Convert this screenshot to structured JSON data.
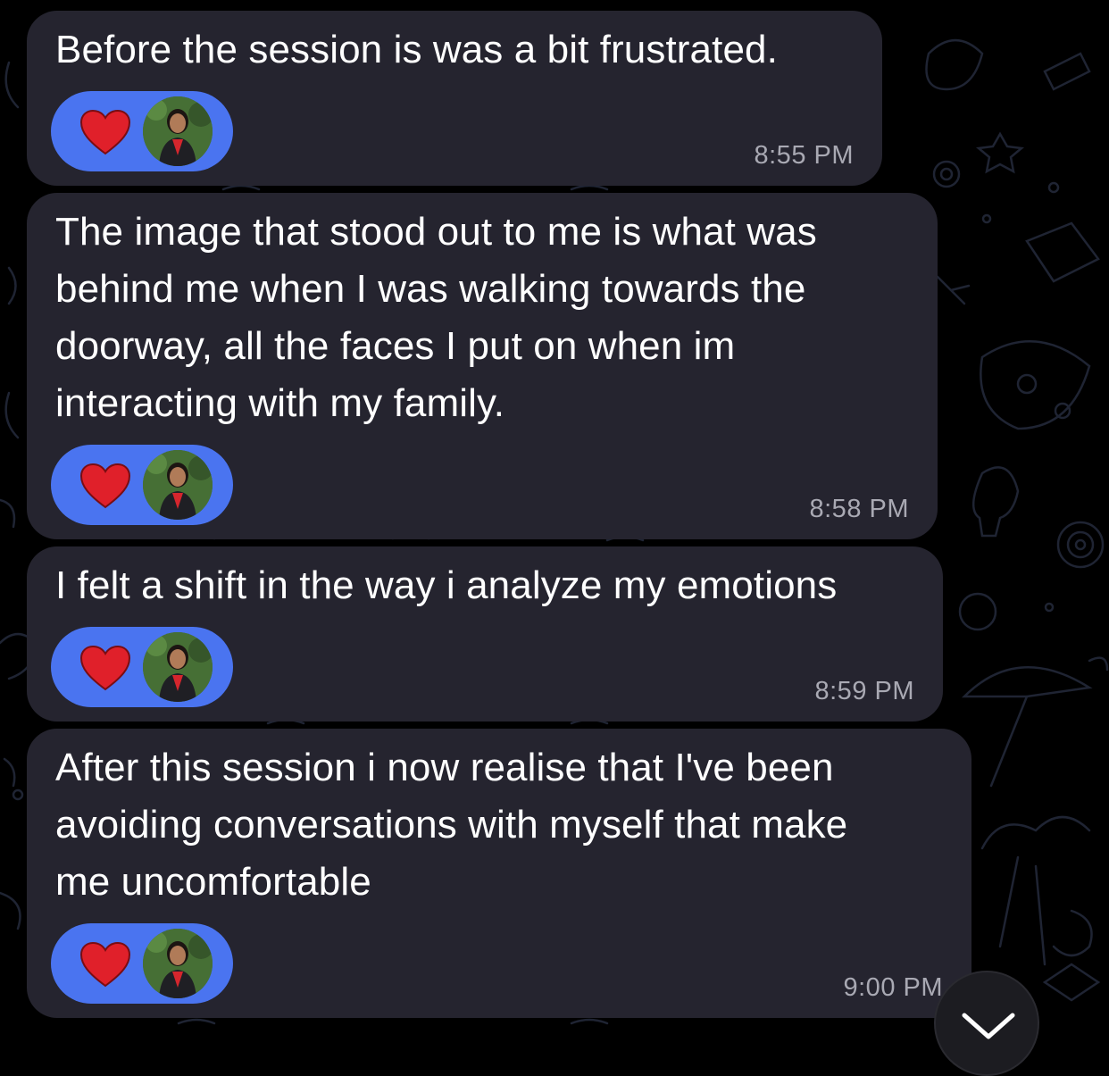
{
  "messages": [
    {
      "text": "Before the session is was a bit frustrated.",
      "time": "8:55 PM",
      "reaction": {
        "emoji": "heart",
        "reactor": "avatar"
      }
    },
    {
      "text": "The image that stood out to me is what was\nbehind me when I was walking towards the\ndoorway, all the faces I put on when im\ninteracting with my family.",
      "time": "8:58 PM",
      "reaction": {
        "emoji": "heart",
        "reactor": "avatar"
      }
    },
    {
      "text": "I felt a shift in the way i analyze my emotions",
      "time": "8:59 PM",
      "reaction": {
        "emoji": "heart",
        "reactor": "avatar"
      }
    },
    {
      "text": "After this session i now realise that I've been\navoiding conversations with myself that make\nme uncomfortable",
      "time": "9:00 PM",
      "reaction": {
        "emoji": "heart",
        "reactor": "avatar"
      }
    }
  ],
  "colors": {
    "background": "#000000",
    "bubble": "#25242f",
    "reaction_pill": "#4a74f0",
    "heart": "#e0202a",
    "timestamp": "#a9a9b3"
  },
  "icons": {
    "heart": "heart-icon",
    "scroll_down": "chevron-down-icon"
  }
}
